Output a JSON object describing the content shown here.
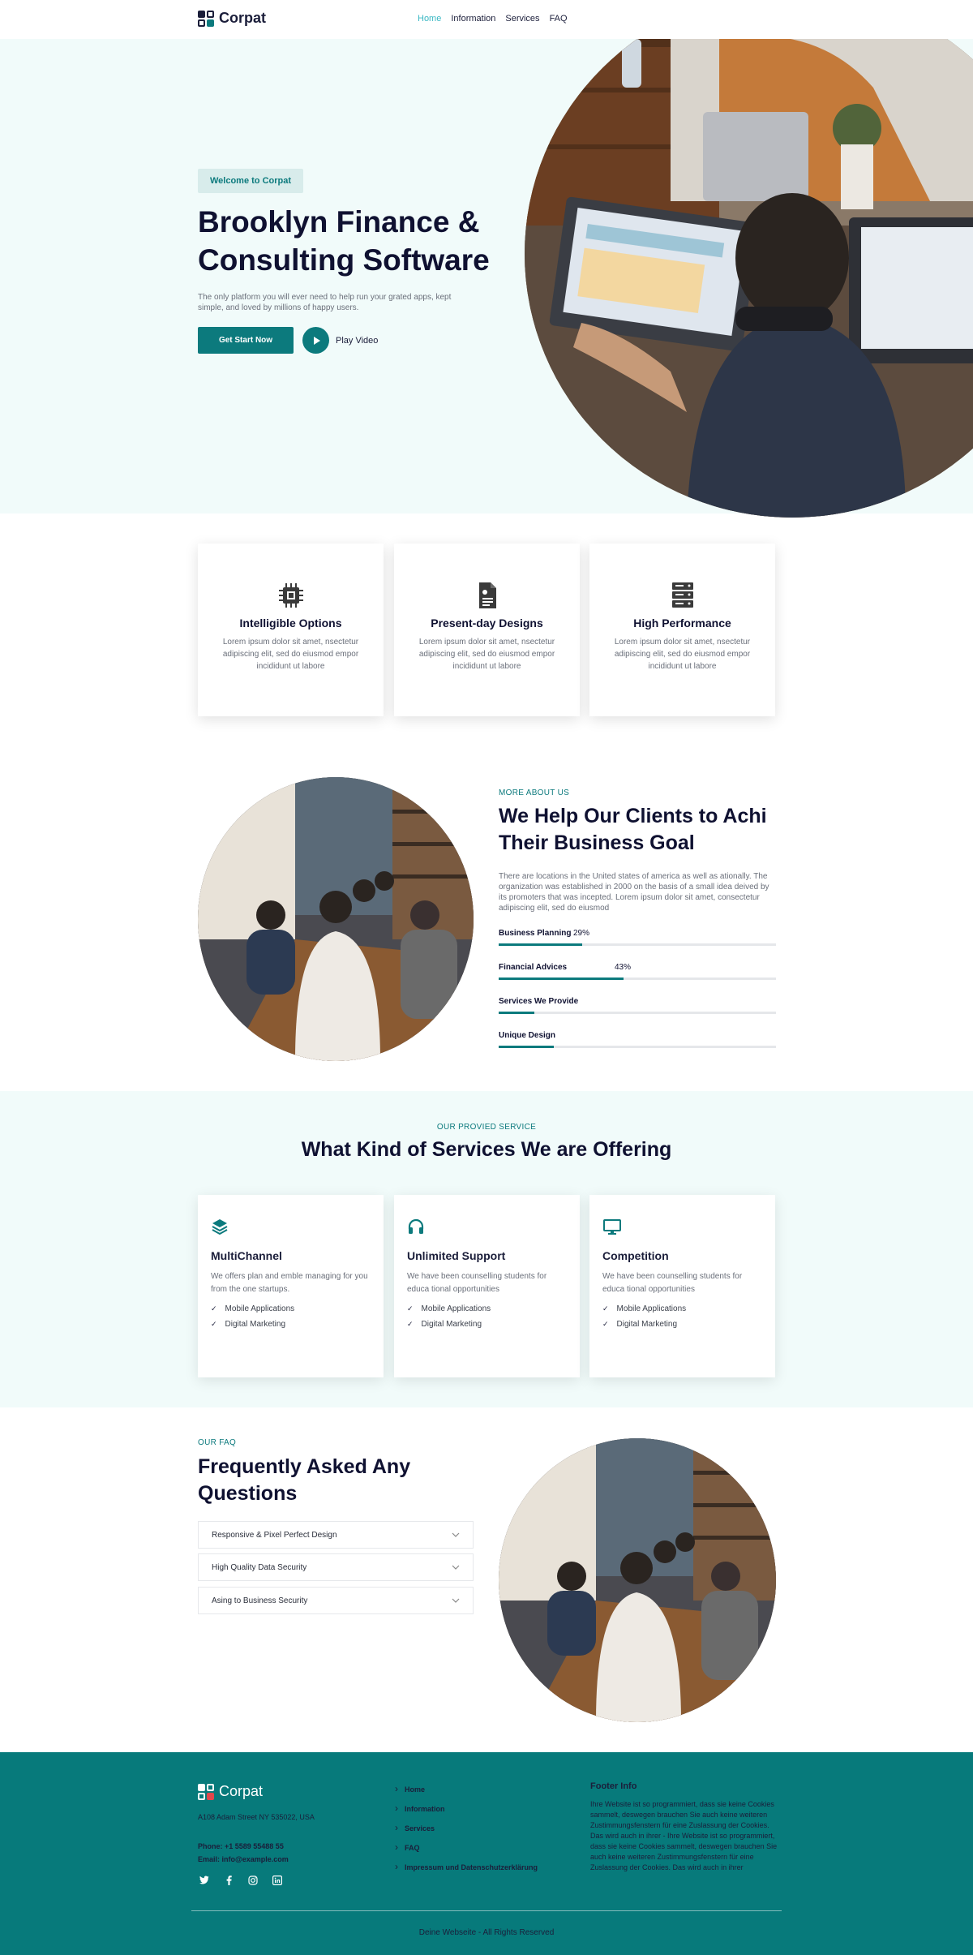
{
  "header": {
    "logo_text": "Corpat",
    "nav": [
      {
        "label": "Home",
        "active": true
      },
      {
        "label": "Information",
        "active": false
      },
      {
        "label": "Services",
        "active": false
      },
      {
        "label": "FAQ",
        "active": false
      }
    ]
  },
  "hero": {
    "badge": "Welcome to Corpat",
    "title": "Brooklyn Finance & Consulting Software",
    "subtitle": "The only platform you will ever need to help run your grated apps, kept simple, and loved by millions of happy users.",
    "cta_label": "Get Start Now",
    "play_label": "Play Video"
  },
  "features": [
    {
      "icon": "cpu-chip-icon",
      "title": "Intelligible Options",
      "text": "Lorem ipsum dolor sit amet, nsectetur adipiscing elit, sed do eiusmod empor incididunt ut labore"
    },
    {
      "icon": "document-icon",
      "title": "Present-day Designs",
      "text": "Lorem ipsum dolor sit amet, nsectetur adipiscing elit, sed do eiusmod empor incididunt ut labore"
    },
    {
      "icon": "server-icon",
      "title": "High Performance",
      "text": "Lorem ipsum dolor sit amet, nsectetur adipiscing elit, sed do eiusmod empor incididunt ut labore"
    }
  ],
  "about": {
    "eyebrow": "MORE ABOUT US",
    "title": "We Help Our Clients to Achi Their Business Goal",
    "text": "There are locations in the United states of america as well as ationally. The organization was established in 2000 on the basis of a small idea deived by its promoters that was incepted. Lorem ipsum dolor sit amet, consectetur adipiscing elit, sed do eiusmod",
    "skills": [
      {
        "label": "Business Planning",
        "percent_label": "29%",
        "value": 0.3
      },
      {
        "label": "Financial Advices",
        "percent_label": "43%",
        "value": 0.45
      },
      {
        "label": "Services We Provide",
        "percent_label": "",
        "value": 0.13
      },
      {
        "label": "Unique Design",
        "percent_label": "",
        "value": 0.2
      }
    ]
  },
  "services": {
    "eyebrow": "OUR PROVIED SERVICE",
    "title": "What Kind of Services We are Offering",
    "cards": [
      {
        "icon": "layers-icon",
        "title": "MultiChannel",
        "text": "We offers plan and emble managing for you from the one startups.",
        "items": [
          "Mobile Applications",
          "Digital Marketing"
        ]
      },
      {
        "icon": "headphones-icon",
        "title": "Unlimited Support",
        "text": "We have been counselling students for educa tional opportunities",
        "items": [
          "Mobile Applications",
          "Digital Marketing"
        ]
      },
      {
        "icon": "monitor-icon",
        "title": "Competition",
        "text": "We have been counselling students for educa tional opportunities",
        "items": [
          "Mobile Applications",
          "Digital Marketing"
        ]
      }
    ]
  },
  "faq": {
    "eyebrow": "OUR FAQ",
    "title": "Frequently Asked Any Questions",
    "items": [
      "Responsive & Pixel Perfect Design",
      "High Quality Data Security",
      "Asing to Business Security"
    ]
  },
  "footer": {
    "logo_text": "Corpat",
    "address": "A108 Adam Street NY 535022, USA",
    "phone": "Phone: +1 5589 55488 55",
    "email": "Email: info@example.com",
    "social": [
      "twitter-icon",
      "facebook-icon",
      "instagram-icon",
      "linkedin-icon"
    ],
    "links": [
      "Home",
      "Information",
      "Services",
      "FAQ",
      "Impressum und Datenschutzerklärung"
    ],
    "info_title": "Footer Info",
    "info_text": "Ihre Website ist so programmiert, dass sie keine Cookies sammelt, deswegen brauchen Sie auch keine weiteren Zustimmungsfenstern für eine Zuslassung der Cookies. Das wird auch in ihrer - Ihre Website ist so programmiert, dass sie keine Cookies sammelt, deswegen brauchen Sie auch keine weiteren Zustimmungsfenstern für eine Zuslassung der Cookies. Das wird auch in ihrer",
    "copyright": "Deine Webseite - All Rights Reserved"
  },
  "colors": {
    "accent": "#0c7a7d",
    "nav_active": "#3bb8c4",
    "light_bg": "#f1fbfa",
    "dark_text": "#0f1131"
  }
}
